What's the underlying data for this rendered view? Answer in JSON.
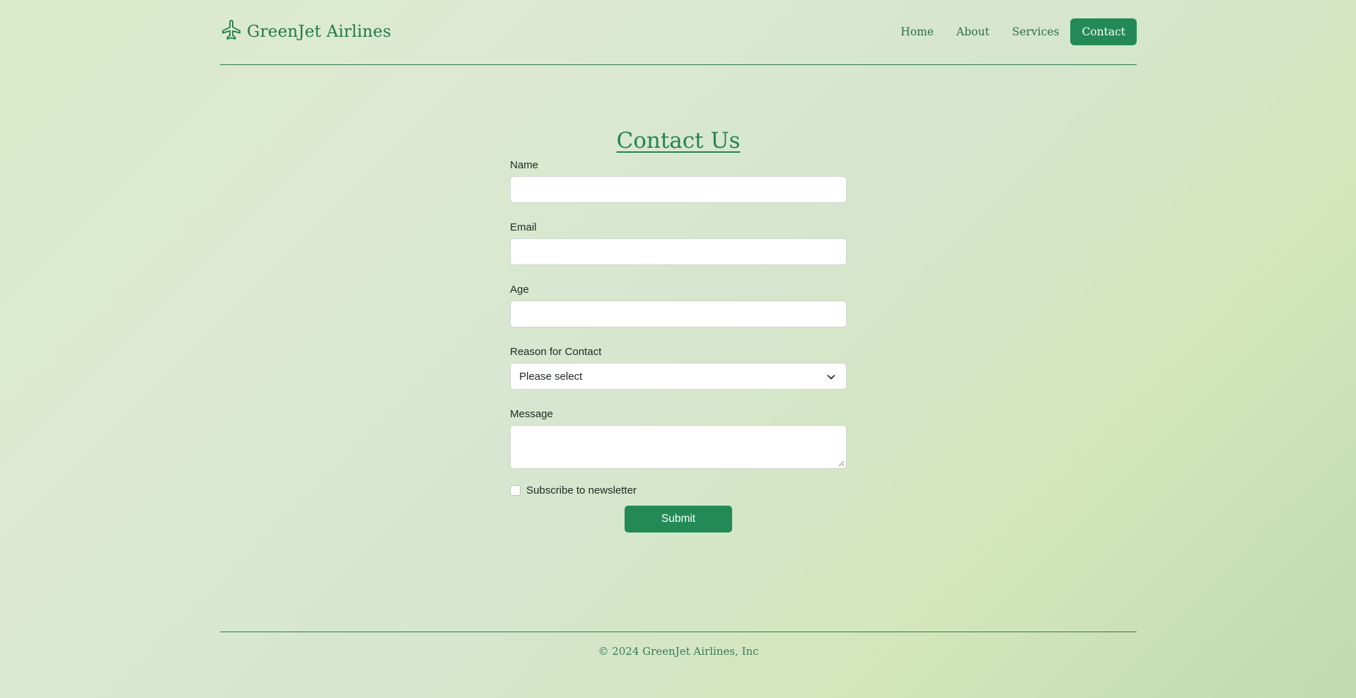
{
  "brand": {
    "name": "GreenJet Airlines",
    "icon": "airplane-icon"
  },
  "nav": {
    "items": [
      {
        "label": "Home"
      },
      {
        "label": "About"
      },
      {
        "label": "Services"
      },
      {
        "label": "Contact",
        "active": true
      }
    ]
  },
  "form": {
    "title": "Contact Us",
    "name": {
      "label": "Name",
      "value": "",
      "placeholder": ""
    },
    "email": {
      "label": "Email",
      "value": "",
      "placeholder": ""
    },
    "age": {
      "label": "Age",
      "value": "",
      "placeholder": ""
    },
    "reason": {
      "label": "Reason for Contact",
      "selected": "Please select"
    },
    "message": {
      "label": "Message",
      "value": ""
    },
    "newsletter": {
      "label": "Subscribe to newsletter",
      "checked": false
    },
    "submit_label": "Submit"
  },
  "footer": {
    "copyright": "© 2024 GreenJet Airlines, Inc"
  },
  "colors": {
    "accent": "#238a56",
    "text_green": "#23784a",
    "rule": "#2a7a4d"
  }
}
